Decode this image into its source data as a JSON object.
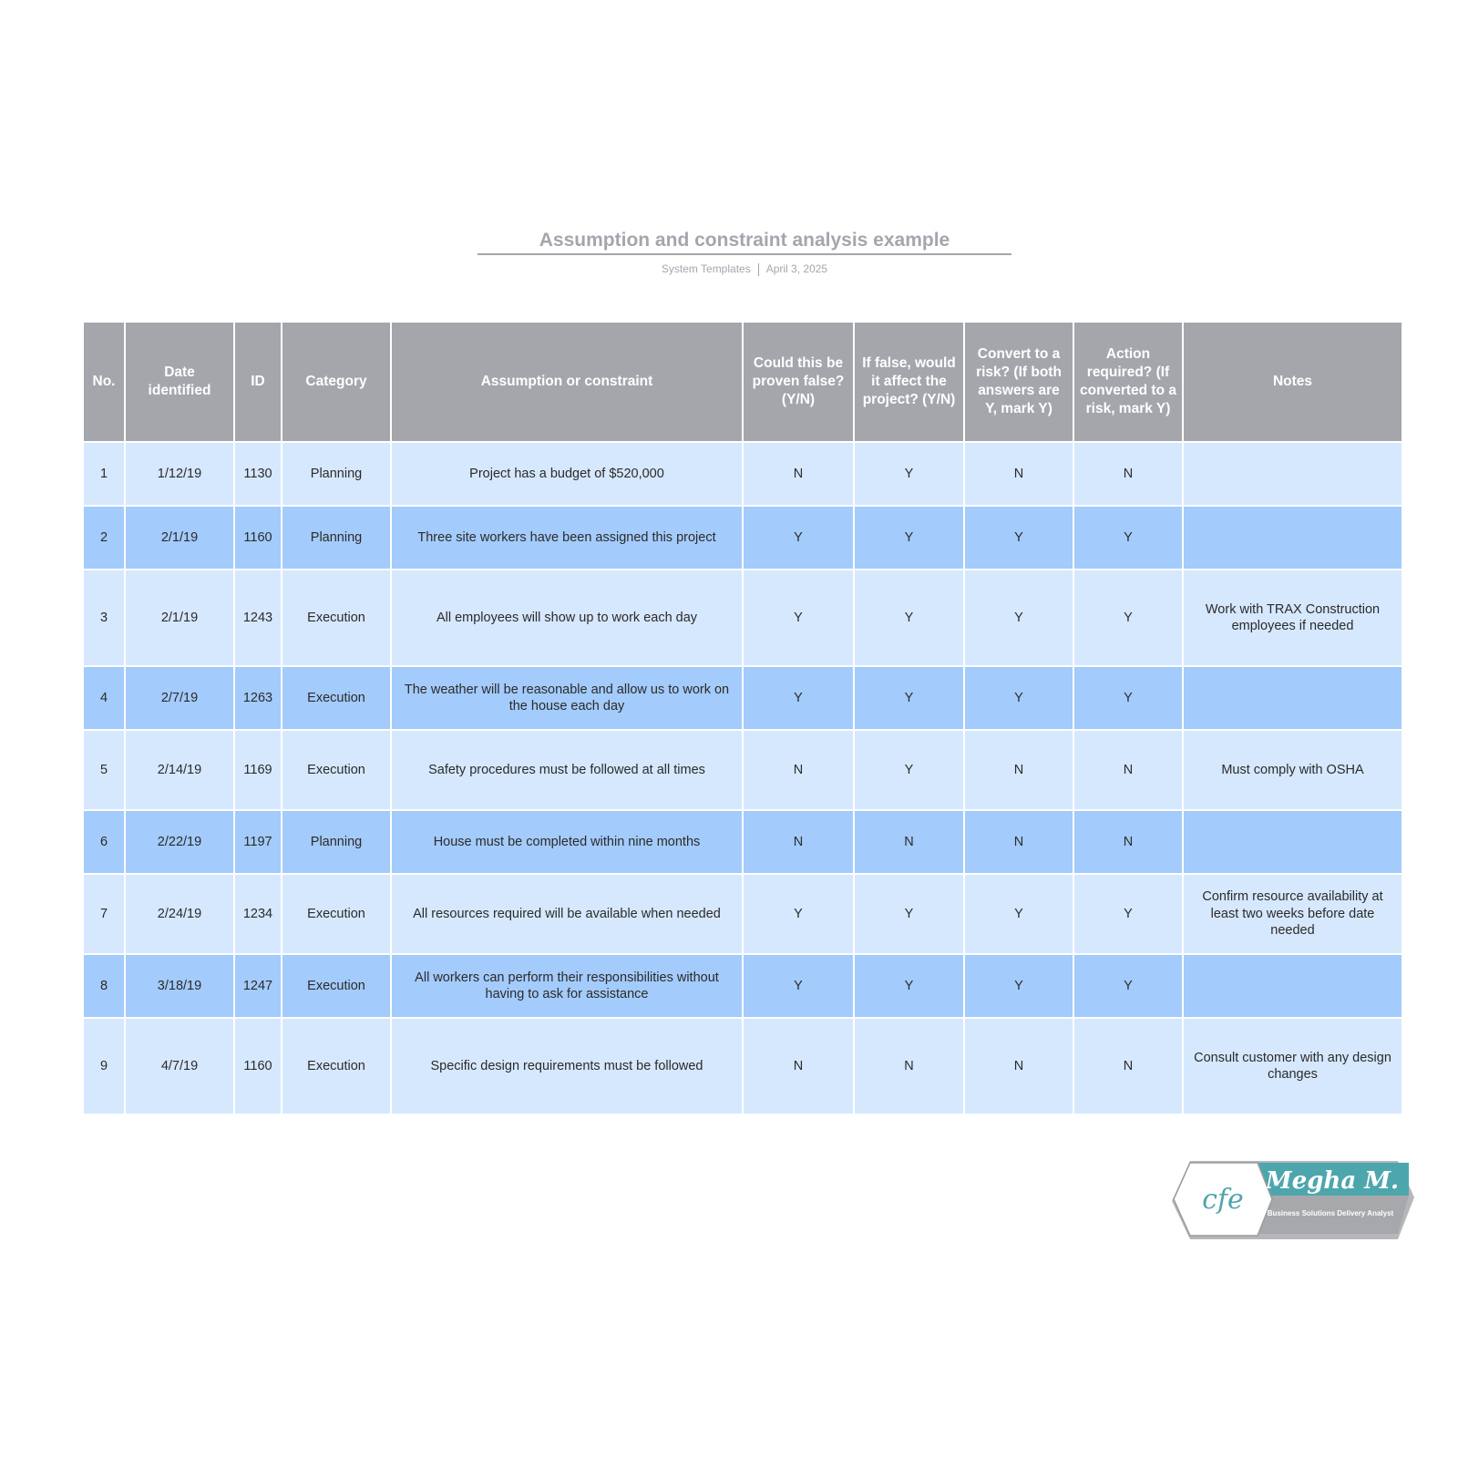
{
  "document": {
    "title": "Assumption and constraint analysis example",
    "author": "System Templates",
    "date": "April 3, 2025"
  },
  "table": {
    "headers": [
      "No.",
      "Date identified",
      "ID",
      "Category",
      "Assumption or constraint",
      "Could this be proven false? (Y/N)",
      "If false, would it affect the project? (Y/N)",
      "Convert to a risk? (If both answers are Y, mark Y)",
      "Action required? (If converted to a risk, mark Y)",
      "Notes"
    ],
    "rows": [
      {
        "no": "1",
        "date": "1/12/19",
        "id": "1130",
        "category": "Planning",
        "assumption": "Project has a budget of $520,000",
        "false": "N",
        "affect": "Y",
        "risk": "N",
        "action": "N",
        "notes": ""
      },
      {
        "no": "2",
        "date": "2/1/19",
        "id": "1160",
        "category": "Planning",
        "assumption": "Three site workers have been assigned this project",
        "false": "Y",
        "affect": "Y",
        "risk": "Y",
        "action": "Y",
        "notes": ""
      },
      {
        "no": "3",
        "date": "2/1/19",
        "id": "1243",
        "category": "Execution",
        "assumption": "All employees will show up to work each day",
        "false": "Y",
        "affect": "Y",
        "risk": "Y",
        "action": "Y",
        "notes": "Work with TRAX Construction employees if needed"
      },
      {
        "no": "4",
        "date": "2/7/19",
        "id": "1263",
        "category": "Execution",
        "assumption": "The weather will be reasonable and allow us to work on the house each day",
        "false": "Y",
        "affect": "Y",
        "risk": "Y",
        "action": "Y",
        "notes": ""
      },
      {
        "no": "5",
        "date": "2/14/19",
        "id": "1169",
        "category": "Execution",
        "assumption": "Safety procedures must be followed at all times",
        "false": "N",
        "affect": "Y",
        "risk": "N",
        "action": "N",
        "notes": "Must comply with OSHA"
      },
      {
        "no": "6",
        "date": "2/22/19",
        "id": "1197",
        "category": "Planning",
        "assumption": "House must be completed within nine months",
        "false": "N",
        "affect": "N",
        "risk": "N",
        "action": "N",
        "notes": ""
      },
      {
        "no": "7",
        "date": "2/24/19",
        "id": "1234",
        "category": "Execution",
        "assumption": "All resources required will be available when needed",
        "false": "Y",
        "affect": "Y",
        "risk": "Y",
        "action": "Y",
        "notes": "Confirm resource availability at least two weeks before date needed"
      },
      {
        "no": "8",
        "date": "3/18/19",
        "id": "1247",
        "category": "Execution",
        "assumption": "All workers can perform their responsibilities without having to ask for assistance",
        "false": "Y",
        "affect": "Y",
        "risk": "Y",
        "action": "Y",
        "notes": ""
      },
      {
        "no": "9",
        "date": "4/7/19",
        "id": "1160",
        "category": "Execution",
        "assumption": "Specific design requirements must be followed",
        "false": "N",
        "affect": "N",
        "risk": "N",
        "action": "N",
        "notes": "Consult customer with any design changes"
      }
    ]
  },
  "badge": {
    "name": "Megha M.",
    "role": "Business Solutions Delivery Analyst",
    "monogram": "cfe"
  },
  "colors": {
    "header_bg": "#a4a6ab",
    "row_light": "#d6e8fe",
    "row_dark": "#a3cbfb",
    "badge_teal": "#4ea6ad",
    "badge_gray": "#a6a8ab"
  }
}
